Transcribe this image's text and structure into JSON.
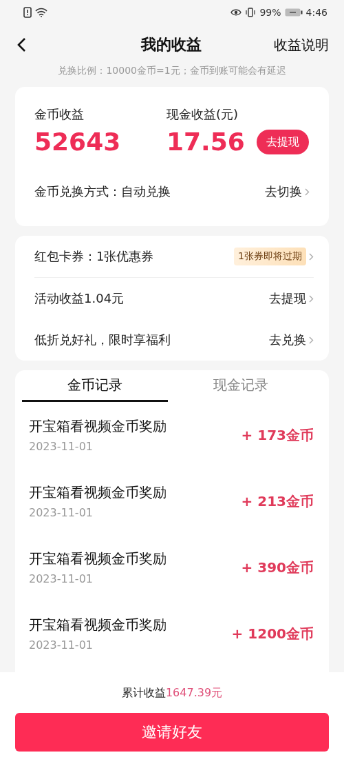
{
  "status_bar": {
    "battery": "99%",
    "time": "4:46"
  },
  "header": {
    "title": "我的收益",
    "action": "收益说明"
  },
  "notice": "兑换比例：10000金币=1元；金币到账可能会有延迟",
  "summary": {
    "coin_label": "金币收益",
    "coin_value": "52643",
    "cash_label": "现金收益(元)",
    "cash_value": "17.56",
    "withdraw_button": "去提现",
    "mode_label": "金币兑换方式：自动兑换",
    "mode_action": "去切换"
  },
  "links": [
    {
      "label": "红包卡券：1张优惠券",
      "action": "1张券即将过期",
      "kind": "badge"
    },
    {
      "label": "活动收益1.04元",
      "action": "去提现",
      "kind": "plain"
    },
    {
      "label": "低折兑好礼，限时享福利",
      "action": "去兑换",
      "kind": "plain"
    }
  ],
  "tabs": [
    {
      "label": "金币记录",
      "selected": true
    },
    {
      "label": "现金记录",
      "selected": false
    }
  ],
  "records": [
    {
      "title": "开宝箱看视频金币奖励",
      "date": "2023-11-01",
      "amount": "+ 173金币"
    },
    {
      "title": "开宝箱看视频金币奖励",
      "date": "2023-11-01",
      "amount": "+ 213金币"
    },
    {
      "title": "开宝箱看视频金币奖励",
      "date": "2023-11-01",
      "amount": "+ 390金币"
    },
    {
      "title": "开宝箱看视频金币奖励",
      "date": "2023-11-01",
      "amount": "+ 1200金币"
    }
  ],
  "footer": {
    "total_label": "累计收益",
    "total_value": "1647.39元",
    "invite_button": "邀请好友"
  }
}
